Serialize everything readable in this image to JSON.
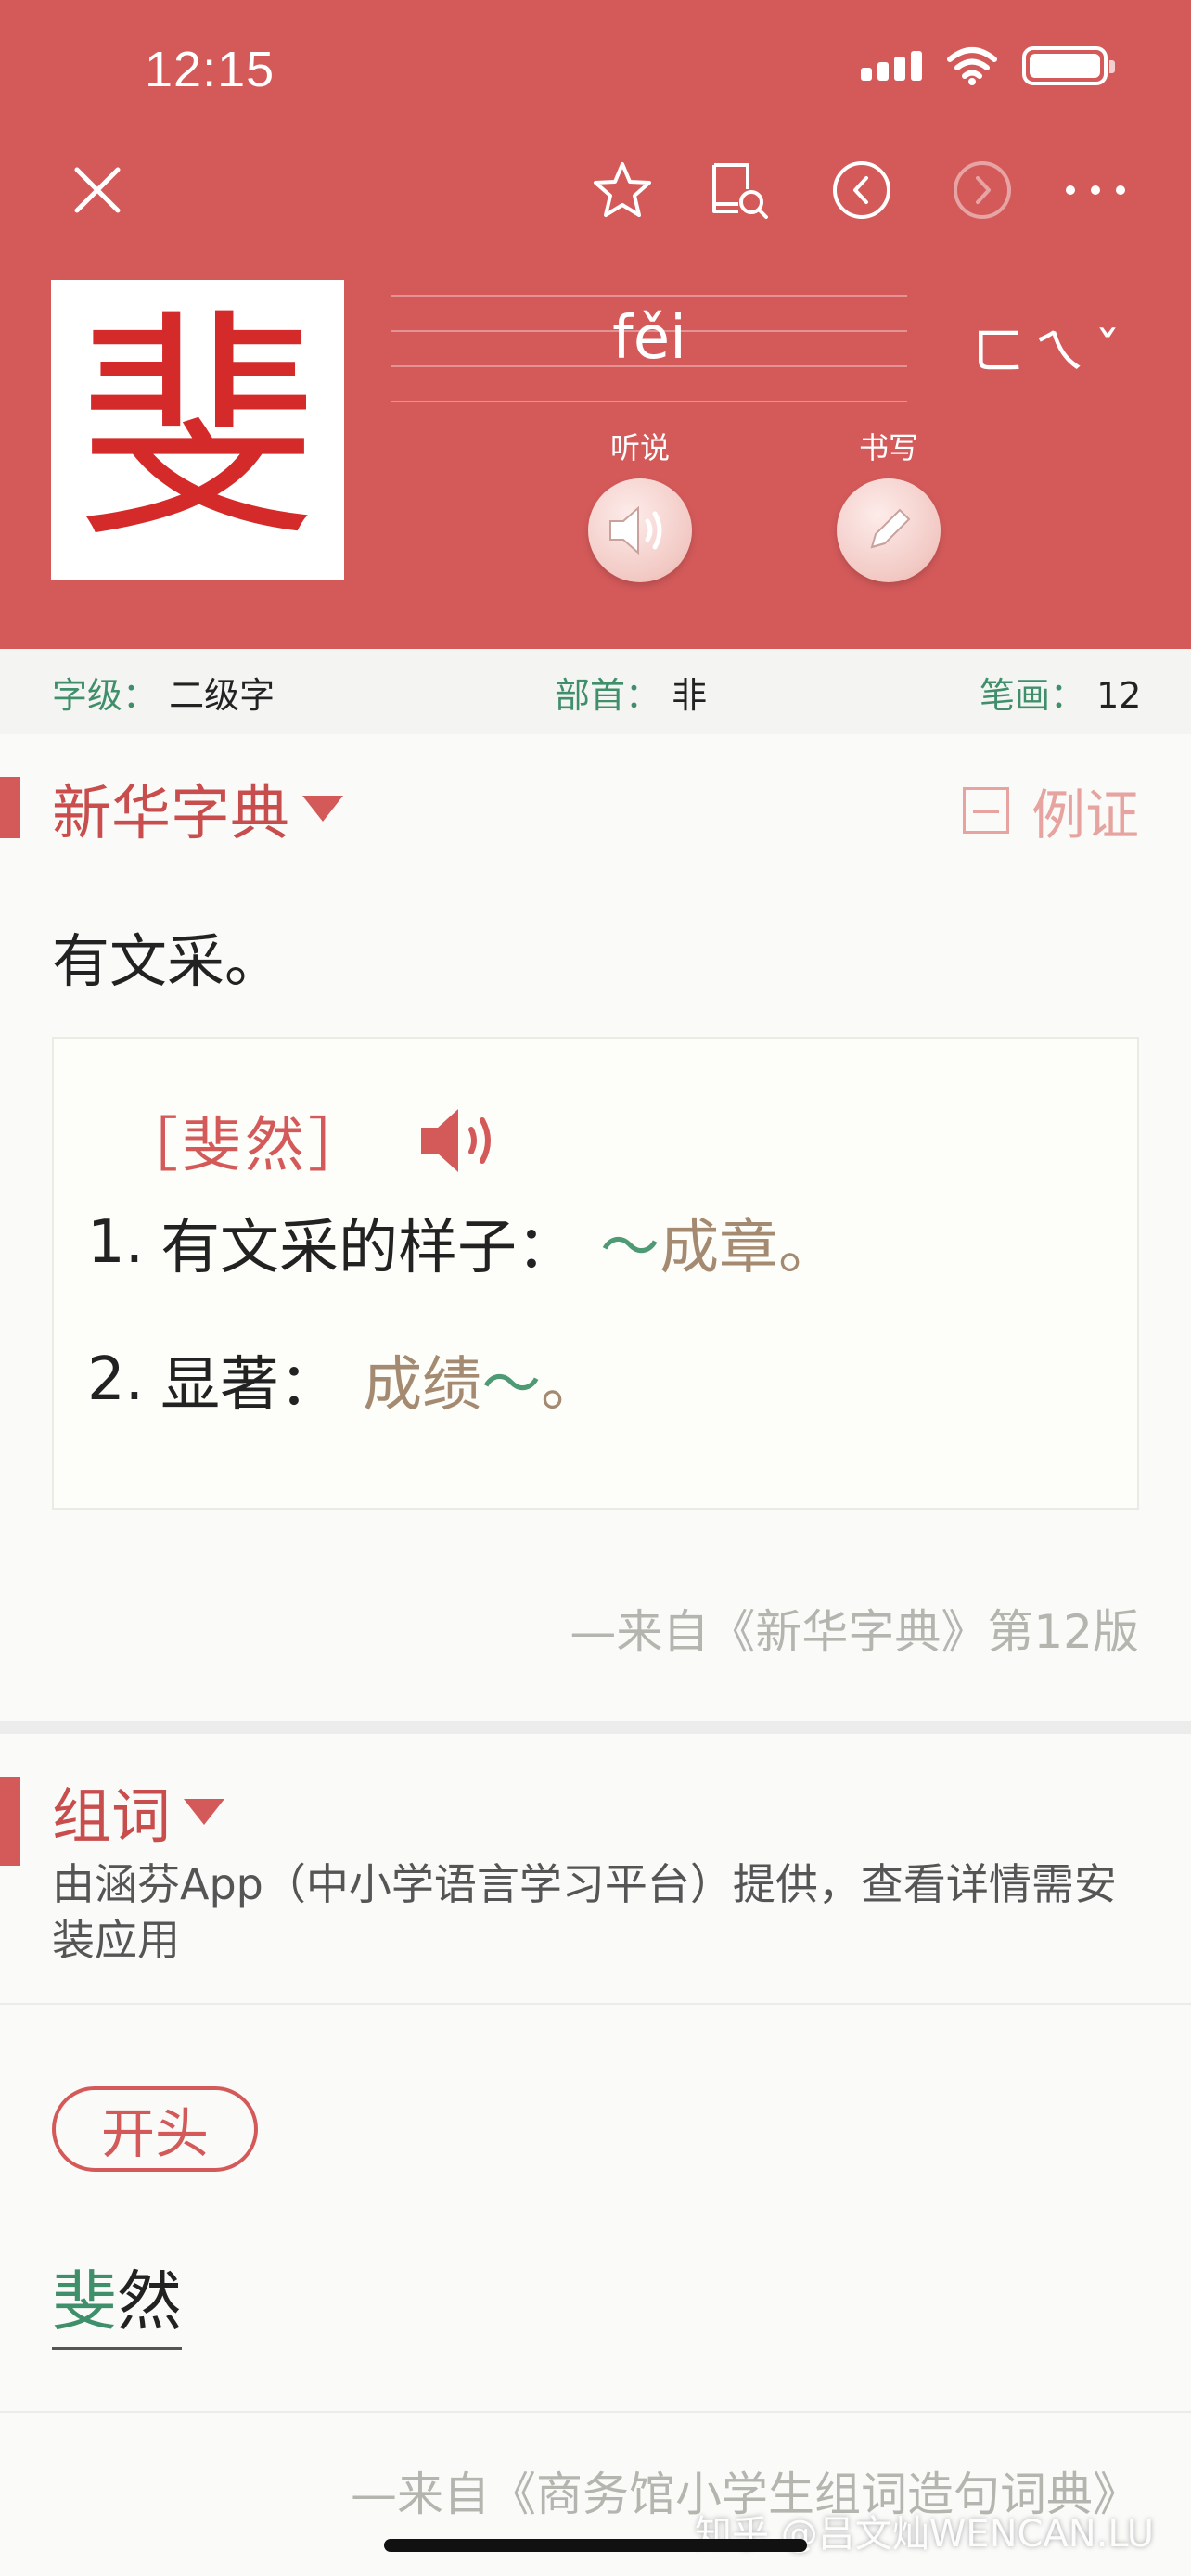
{
  "status_bar": {
    "time": "12:15"
  },
  "header": {
    "character": "斐",
    "pinyin": "fěi",
    "zhuyin": "ㄈㄟˇ",
    "listen_label": "听说",
    "write_label": "书写"
  },
  "info": {
    "level_label": "字级",
    "level_value": "二级字",
    "radical_label": "部首",
    "radical_value": "非",
    "strokes_label": "笔画",
    "strokes_value": "12"
  },
  "dictionary": {
    "title": "新华字典",
    "example_toggle": "例证",
    "definition": "有文采。",
    "word": {
      "open_bracket": "［",
      "headword": "斐然",
      "close_bracket": "］",
      "senses": [
        {
          "num": "1.",
          "text": "有文采的样子：",
          "ex_tilde": "～",
          "ex_text": "成章",
          "ex_end": "。"
        },
        {
          "num": "2.",
          "text": "显著：",
          "ex_text": "成绩",
          "ex_tilde": "～",
          "ex_end": "。"
        }
      ]
    },
    "source": "—来自《新华字典》第12版"
  },
  "compound": {
    "title": "组词",
    "provider": "由涵芬App（中小学语言学习平台）提供，查看详情需安装应用",
    "tag": "开头",
    "word_char1": "斐",
    "word_char2": "然",
    "source": "—来自《商务馆小学生组词造句词典》"
  },
  "watermark": "知乎 @吕文灿WENCAN.LU",
  "colors": {
    "header_red": "#d45a5a",
    "accent_green": "#3f8f6b",
    "example_brown": "#a58a72"
  }
}
